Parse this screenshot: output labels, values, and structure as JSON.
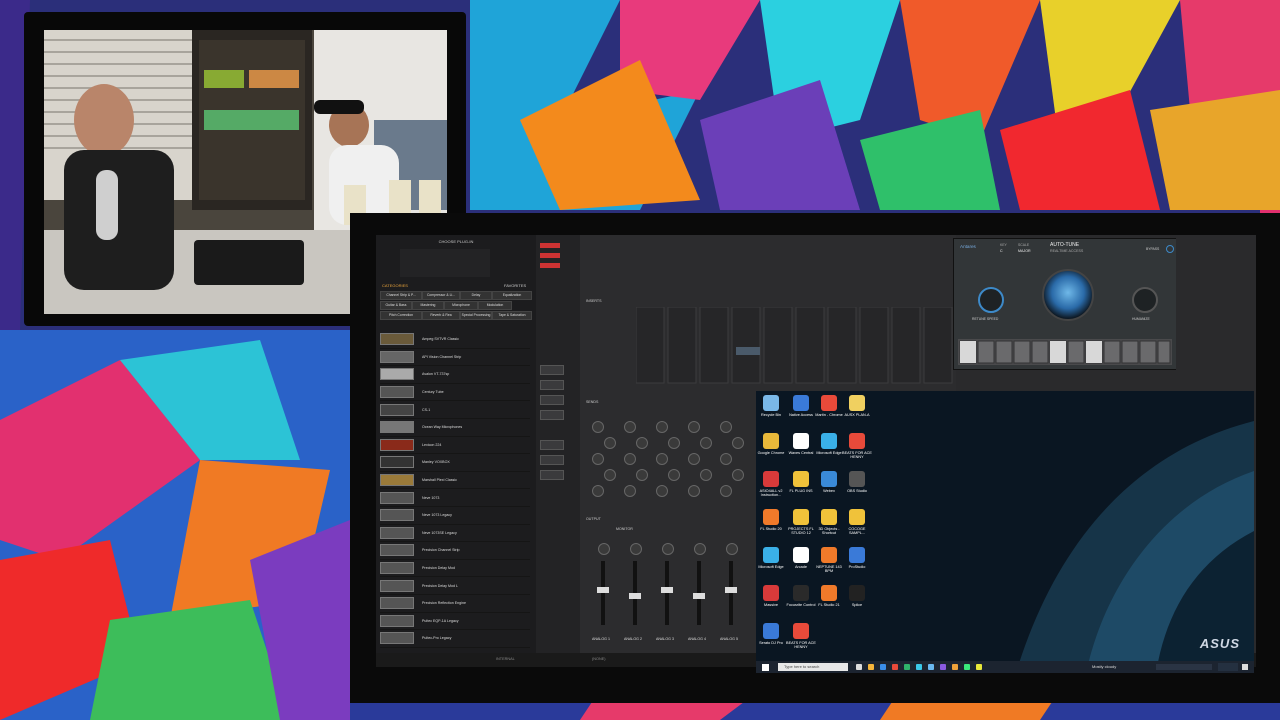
{
  "colors": {
    "accent": "#e7a23b",
    "autotune_blue": "#3d8ac9"
  },
  "browser": {
    "title": "CHOOSE PLUG-IN",
    "categories_label": "CATEGORIES",
    "favorites_label": "FAVORITES",
    "category_buttons": [
      "Channel Strip & P...",
      "Compressor & Li...",
      "Delay",
      "Equalization",
      "Guitar & Bass",
      "Mastering",
      "Microphone",
      "Modulation",
      "Pitch Correction",
      "Reverb & Rea",
      "Special Processing",
      "Tape & Saturation"
    ],
    "plugins": [
      "Ampeg SVTVR Classic",
      "API Vision Channel Strip",
      "Avalon VT-737sp",
      "Century Tube",
      "CS-1",
      "Ocean Way Microphones",
      "Lexicon 224",
      "Manley VOXBOX",
      "Marshall Plexi Classic",
      "Neve 1073",
      "Neve 1073 Legacy",
      "Neve 1073SE Legacy",
      "Precision Channel Strip",
      "Precision Delay Mod",
      "Precision Delay Mod L",
      "Precision Reflection Engine",
      "Pultec EQP-1A Legacy",
      "Pultec-Pro Legacy"
    ]
  },
  "mixer": {
    "channels": [
      "ANALOG 1",
      "ANALOG 2",
      "ANALOG 3",
      "ANALOG 4",
      "ANALOG 5"
    ],
    "inserts_label": "INSERTS",
    "sends_label": "SENDS",
    "output_label": "OUTPUT",
    "monitor_label": "MONITOR"
  },
  "autotune": {
    "brand": "Antares",
    "title": "AUTO-TUNE",
    "subtitle": "REALTIME ACCESS",
    "key_label": "KEY",
    "scale_label": "SCALE",
    "key_value": "C",
    "scale_value": "MAJOR",
    "bypass_label": "BYPASS",
    "retune_label": "RETUNE SPEED",
    "humanize_label": "HUMANIZE"
  },
  "statusbar": {
    "text": "INTERNAL",
    "value": "(NONE)"
  },
  "desktop": {
    "icons": [
      "Recycle Bin",
      "Native Access",
      "Martin - Chrome",
      "AUSX PLAN-A",
      "Google Chrome",
      "Waves Central",
      "Microsoft Edge",
      "BEATS FOR ACE HENNY",
      "ASIO4ALL v2 Instruction...",
      "FL PLUG INS",
      "Webex",
      "OBS Studio",
      "FL Studio 20",
      "PROJECTS FL STUDIO 12",
      "3D Objects - Shortcut",
      "COCOGE SAMPL...",
      "Microsoft Edge",
      "Arcade",
      "NEPTUNE 143 BPM",
      "ProStudio",
      "Massive",
      "Focusrite Control",
      "FL Studio 21",
      "Splice",
      "Serato DJ Pro",
      "BEATS FOR ACE HENNY"
    ],
    "taskbar_search": "Type here to search",
    "weather": "Mostly cloudy",
    "brand": "ASUS"
  }
}
